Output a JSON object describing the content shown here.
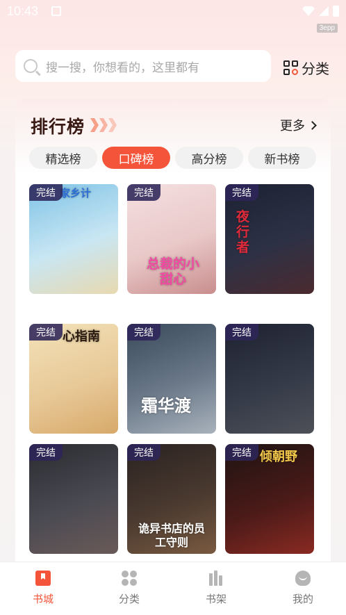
{
  "status_bar": {
    "time": "10:43",
    "app_tag": "3epp"
  },
  "search": {
    "placeholder": "搜一搜，你想看的，这里都有"
  },
  "header": {
    "category_label": "分类"
  },
  "ranking": {
    "title": "排行榜",
    "more_label": "更多",
    "tabs": [
      {
        "label": "精选榜",
        "active": false
      },
      {
        "label": "口碑榜",
        "active": true
      },
      {
        "label": "高分榜",
        "active": false
      },
      {
        "label": "新书榜",
        "active": false
      }
    ],
    "books": [
      {
        "badge": "完结",
        "cover_text": "家乡计",
        "colors": [
          "#7fc3e6",
          "#c8e6f3",
          "#e8d9b0"
        ],
        "text_color": "#2b6fd6"
      },
      {
        "badge": "完结",
        "cover_text": "总裁的小甜心",
        "colors": [
          "#f5dfe0",
          "#e9c8c8",
          "#c98d8d"
        ],
        "text_color": "#f24aa2"
      },
      {
        "badge": "完结",
        "cover_text": "夜行者",
        "colors": [
          "#1b2233",
          "#2d3145",
          "#4b2a2f"
        ],
        "text_color": "#e02a3a"
      },
      {
        "badge": "完结",
        "cover_text": "心指南",
        "colors": [
          "#f2e2b8",
          "#e8c998",
          "#d7a96a"
        ],
        "text_color": "#2a1a10"
      },
      {
        "badge": "完结",
        "cover_text": "霜华渡",
        "colors": [
          "#3a4a5c",
          "#6a7888",
          "#a8b2bc"
        ],
        "text_color": "#ffffff"
      },
      {
        "badge": "完结",
        "cover_text": "",
        "colors": [
          "#1e2230",
          "#343a48",
          "#4e5058"
        ],
        "text_color": "#ffd84a"
      },
      {
        "badge": "完结",
        "cover_text": "",
        "colors": [
          "#2a2a30",
          "#4a4a52",
          "#6a5a58"
        ],
        "text_color": "#ffffff"
      },
      {
        "badge": "完结",
        "cover_text": "诡异书店的员工守则",
        "colors": [
          "#2a2220",
          "#4a3a30",
          "#7a5a40"
        ],
        "text_color": "#ffffff"
      },
      {
        "badge": "完结",
        "cover_text": "倾朝野",
        "colors": [
          "#1e1412",
          "#4a1a18",
          "#8a2a22"
        ],
        "text_color": "#f2c84a"
      }
    ]
  },
  "bottom_nav": [
    {
      "label": "书城",
      "icon": "book-icon",
      "active": true
    },
    {
      "label": "分类",
      "icon": "clover-icon",
      "active": false
    },
    {
      "label": "书架",
      "icon": "shelf-icon",
      "active": false
    },
    {
      "label": "我的",
      "icon": "user-icon",
      "active": false
    }
  ]
}
